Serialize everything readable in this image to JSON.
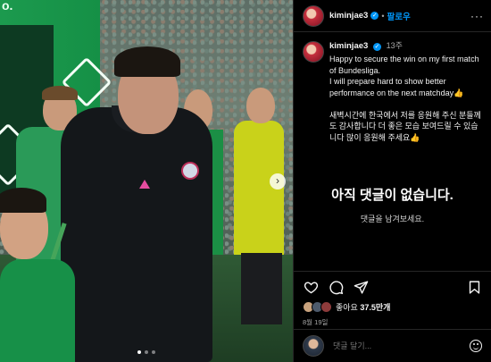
{
  "photo": {
    "watermark_text": "o.",
    "carousel": {
      "slides": 3,
      "active_index": 0,
      "next_symbol": "›"
    }
  },
  "header": {
    "username": "kiminjae3",
    "verified_symbol": "✓",
    "separator": "•",
    "follow_label": "팔로우",
    "more_symbol": "···"
  },
  "caption": {
    "username": "kiminjae3",
    "verified_symbol": "✓",
    "time": "13주",
    "text": "Happy to secure the win on my first match of Bundesliga.\nI will prepare hard to show better performance on the next matchday👍\n\n새벽시간에 한국에서 저를 응원해 주신 분들께도 감사합니다 더 좋은 모습 보여드릴 수 있습니다 많이 응원해 주세요👍"
  },
  "comments": {
    "empty_title": "아직 댓글이 없습니다.",
    "empty_subtitle": "댓글을 남겨보세요."
  },
  "actions": {
    "icons": [
      "heart-icon",
      "comment-icon",
      "share-icon",
      "bookmark-icon"
    ],
    "likes_label": "좋아요",
    "likes_count": "37.5만개",
    "date": "8월 19일"
  },
  "comment_box": {
    "placeholder": "댓글 달기..."
  },
  "colors": {
    "accent": "#0095f6",
    "background": "#000000",
    "secondary_text": "#a8a8a8"
  }
}
